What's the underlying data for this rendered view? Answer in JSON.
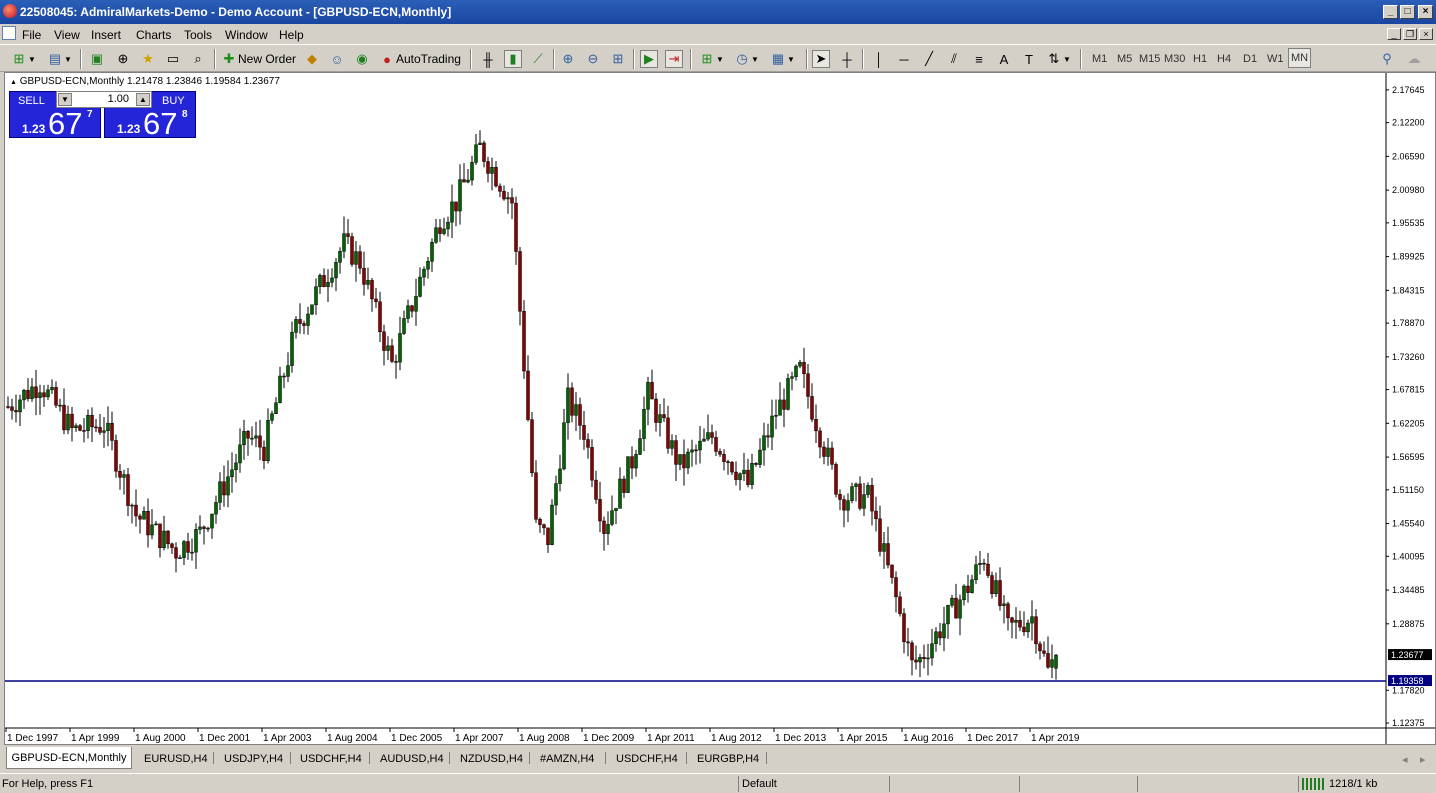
{
  "window": {
    "title": "22508045: AdmiralMarkets-Demo - Demo Account - [GBPUSD-ECN,Monthly]"
  },
  "menu": [
    "File",
    "View",
    "Insert",
    "Charts",
    "Tools",
    "Window",
    "Help"
  ],
  "toolbar": {
    "new_order_label": "New Order",
    "autotrading_label": "AutoTrading",
    "timeframes": [
      "M1",
      "M5",
      "M15",
      "M30",
      "H1",
      "H4",
      "D1",
      "W1",
      "MN"
    ],
    "active_timeframe": "MN"
  },
  "chart": {
    "header": "GBPUSD-ECN,Monthly  1.21478 1.23846 1.19584 1.23677",
    "trade_panel": {
      "sell_label": "SELL",
      "buy_label": "BUY",
      "lot": "1.00",
      "sell_price_small": "1.23",
      "sell_price_big": "67",
      "sell_price_sup": "7",
      "buy_price_small": "1.23",
      "buy_price_big": "67",
      "buy_price_sup": "8"
    },
    "current_price_label": "1.23677",
    "hline_price_label": "1.19358",
    "hline_color": "#000080"
  },
  "chart_data": {
    "type": "candlestick",
    "symbol": "GBPUSD-ECN",
    "timeframe": "Monthly",
    "ohlc_last": {
      "open": 1.21478,
      "high": 1.23846,
      "low": 1.19584,
      "close": 1.23677
    },
    "y_ticks": [
      "2.17645",
      "2.12200",
      "2.06590",
      "2.00980",
      "1.95535",
      "1.89925",
      "1.84315",
      "1.78870",
      "1.73260",
      "1.67815",
      "1.62205",
      "1.56595",
      "1.51150",
      "1.45540",
      "1.40095",
      "1.34485",
      "1.28875",
      "1.23677",
      "1.19358",
      "1.17820",
      "1.12375"
    ],
    "x_ticks": [
      "1 Dec 1997",
      "1 Apr 1999",
      "1 Aug 2000",
      "1 Dec 2001",
      "1 Apr 2003",
      "1 Aug 2004",
      "1 Dec 2005",
      "1 Apr 2007",
      "1 Aug 2008",
      "1 Dec 2009",
      "1 Apr 2011",
      "1 Aug 2012",
      "1 Dec 2013",
      "1 Apr 2015",
      "1 Aug 2016",
      "1 Dec 2017",
      "1 Apr 2019"
    ],
    "ylim": [
      1.1155,
      2.2045
    ],
    "horizontal_line": 1.19358,
    "close_anchors": [
      {
        "x": "1 Dec 1997",
        "y": 1.65
      },
      {
        "x": "1 Aug 1998",
        "y": 1.69
      },
      {
        "x": "1 Apr 1999",
        "y": 1.61
      },
      {
        "x": "1 Dec 1999",
        "y": 1.62
      },
      {
        "x": "1 Aug 2000",
        "y": 1.47
      },
      {
        "x": "1 Jun 2001",
        "y": 1.41
      },
      {
        "x": "1 Dec 2001",
        "y": 1.44
      },
      {
        "x": "1 Dec 2002",
        "y": 1.6
      },
      {
        "x": "1 Apr 2003",
        "y": 1.58
      },
      {
        "x": "1 Dec 2003",
        "y": 1.78
      },
      {
        "x": "1 Dec 2004",
        "y": 1.92
      },
      {
        "x": "1 Apr 2005",
        "y": 1.89
      },
      {
        "x": "1 Oct 2005",
        "y": 1.76
      },
      {
        "x": "1 Dec 2005",
        "y": 1.72
      },
      {
        "x": "1 Dec 2006",
        "y": 1.96
      },
      {
        "x": "1 Apr 2007",
        "y": 1.99
      },
      {
        "x": "1 Oct 2007",
        "y": 2.08
      },
      {
        "x": "1 Jun 2008",
        "y": 1.99
      },
      {
        "x": "1 Dec 2008",
        "y": 1.45
      },
      {
        "x": "1 Mar 2009",
        "y": 1.43
      },
      {
        "x": "1 Aug 2009",
        "y": 1.66
      },
      {
        "x": "1 Dec 2009",
        "y": 1.61
      },
      {
        "x": "1 May 2010",
        "y": 1.45
      },
      {
        "x": "1 Dec 2010",
        "y": 1.56
      },
      {
        "x": "1 Apr 2011",
        "y": 1.67
      },
      {
        "x": "1 Dec 2011",
        "y": 1.55
      },
      {
        "x": "1 Aug 2012",
        "y": 1.6
      },
      {
        "x": "1 May 2013",
        "y": 1.52
      },
      {
        "x": "1 Dec 2013",
        "y": 1.64
      },
      {
        "x": "1 Jun 2014",
        "y": 1.71
      },
      {
        "x": "1 Apr 2015",
        "y": 1.5
      },
      {
        "x": "1 Nov 2015",
        "y": 1.5
      },
      {
        "x": "1 Jun 2016",
        "y": 1.33
      },
      {
        "x": "1 Oct 2016",
        "y": 1.22
      },
      {
        "x": "1 Dec 2016",
        "y": 1.23
      },
      {
        "x": "1 Dec 2017",
        "y": 1.35
      },
      {
        "x": "1 Apr 2018",
        "y": 1.4
      },
      {
        "x": "1 Oct 2018",
        "y": 1.28
      },
      {
        "x": "1 Apr 2019",
        "y": 1.3
      },
      {
        "x": "1 Aug 2019",
        "y": 1.21
      },
      {
        "x": "1 Oct 2019",
        "y": 1.2368
      }
    ],
    "bull_color": "#006400",
    "bear_color": "#8b0000"
  },
  "tabs": [
    "GBPUSD-ECN,Monthly",
    "EURUSD,H4",
    "USDJPY,H4",
    "USDCHF,H4",
    "AUDUSD,H4",
    "NZDUSD,H4",
    "#AMZN,H4",
    "USDCHF,H4",
    "EURGBP,H4"
  ],
  "active_tab": "GBPUSD-ECN,Monthly",
  "status": {
    "help": "For Help, press F1",
    "profile": "Default",
    "traffic": "1218/1 kb"
  }
}
